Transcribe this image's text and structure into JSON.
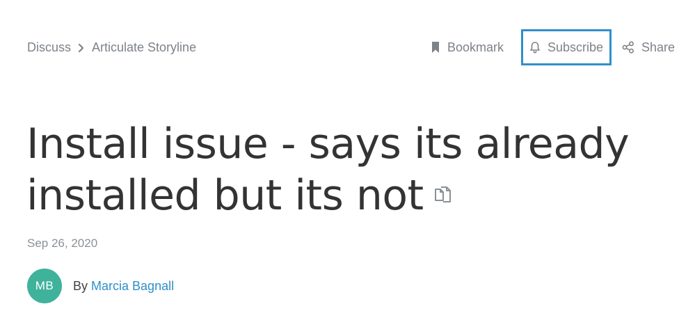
{
  "breadcrumb": {
    "items": [
      {
        "label": "Discuss"
      },
      {
        "label": "Articulate Storyline"
      }
    ]
  },
  "actions": {
    "bookmark": {
      "label": "Bookmark",
      "icon": "bookmark-icon"
    },
    "subscribe": {
      "label": "Subscribe",
      "icon": "bell-icon",
      "highlight_color": "#2f8fc9"
    },
    "share": {
      "label": "Share",
      "icon": "share-icon"
    }
  },
  "post": {
    "title": "Install issue - says its already installed but its not",
    "title_icon": "copy-icon",
    "date": "Sep 26, 2020",
    "author": {
      "initials": "MB",
      "by_label": "By",
      "name": "Marcia Bagnall",
      "avatar_color": "#3fb29c",
      "link_color": "#2f8fc9"
    }
  }
}
